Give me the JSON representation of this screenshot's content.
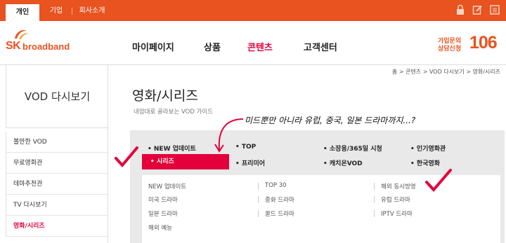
{
  "topbar": {
    "tabs": [
      {
        "label": "개인",
        "active": true
      },
      {
        "label": "기업",
        "active": false
      },
      {
        "label": "회사소개",
        "active": false
      }
    ],
    "icons": [
      "lock-icon",
      "edit-icon",
      "menu-icon"
    ]
  },
  "logo": {
    "sk": "SK",
    "broadband": "broadband"
  },
  "gnb": {
    "items": [
      {
        "label": "마이페이지",
        "active": false
      },
      {
        "label": "상품",
        "active": false
      },
      {
        "label": "콘텐츠",
        "active": true
      },
      {
        "label": "고객센터",
        "active": false
      }
    ]
  },
  "promo": {
    "line1": "가입문의",
    "line2": "상담신청",
    "number": "106"
  },
  "breadcrumb": "홈 > 콘텐츠 > VOD 다시보기 > 영화/시리즈",
  "lnb": {
    "title": "VOD 다시보기",
    "items": [
      {
        "label": "볼만한 VOD",
        "active": false
      },
      {
        "label": "무료영화관",
        "active": false
      },
      {
        "label": "테마추천관",
        "active": false
      },
      {
        "label": "TV 다시보기",
        "active": false
      },
      {
        "label": "영화/시리즈",
        "active": true
      }
    ]
  },
  "main": {
    "title": "영화/시리즈",
    "subtitle": "내맘대로 골라보는 VOD 가이드",
    "annotation": "미드뿐만 아니라 유럽, 중국, 일본 드라마까지...?"
  },
  "categories": [
    {
      "label": "• NEW 업데이트",
      "selected": false
    },
    {
      "label": "• TOP",
      "selected": false
    },
    {
      "label": "• 소장용/365일 시청",
      "selected": false
    },
    {
      "label": "• 인기영화관",
      "selected": false
    },
    {
      "label": "• 시리즈",
      "selected": true
    },
    {
      "label": "• 프리미어",
      "selected": false
    },
    {
      "label": "• 캐치온VOD",
      "selected": false
    },
    {
      "label": "• 한국영화",
      "selected": false
    }
  ],
  "subcategories": [
    "NEW 업데이트",
    "TOP 30",
    "해외 동시방영",
    "미국 드라마",
    "중화 드라마",
    "유럽 드라마",
    "일본 드라마",
    "꿀드 드라마",
    "IPTV 드라마",
    "해외 예능"
  ],
  "colors": {
    "brand": "#e8531f",
    "accent": "#e4003a"
  }
}
